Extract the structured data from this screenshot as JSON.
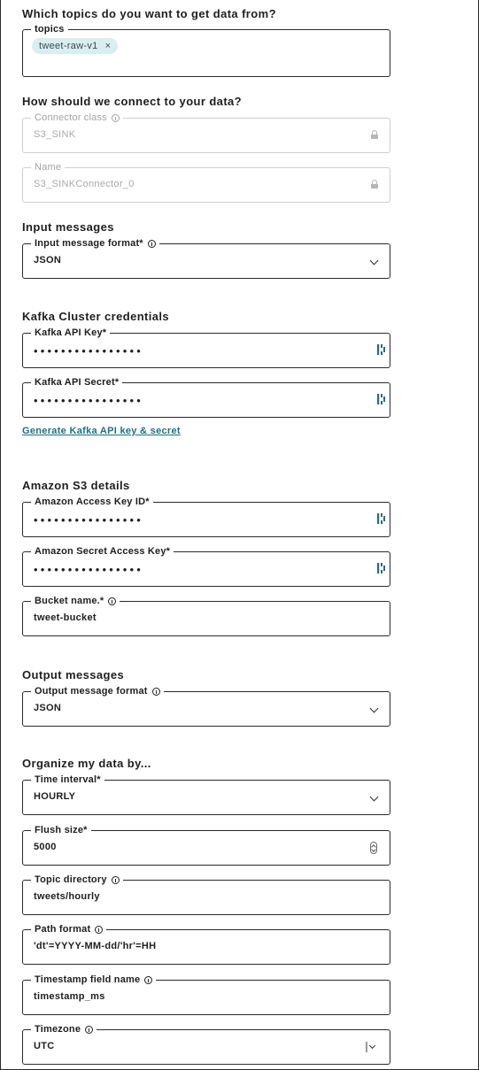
{
  "topics_section": {
    "title": "Which topics do you want to get data from?",
    "label": "topics",
    "chips": [
      "tweet-raw-v1"
    ],
    "chip_remove": "×"
  },
  "connection_section": {
    "title": "How should we connect to your data?",
    "connector_class": {
      "label": "Connector class",
      "value": "S3_SINK"
    },
    "name": {
      "label": "Name",
      "value": "S3_SINKConnector_0"
    }
  },
  "input_section": {
    "title": "Input messages",
    "format": {
      "label": "Input message format*",
      "value": "JSON"
    }
  },
  "kafka_section": {
    "title": "Kafka Cluster credentials",
    "api_key": {
      "label": "Kafka API Key*",
      "value": "••••••••••••••••"
    },
    "api_secret": {
      "label": "Kafka API Secret*",
      "value": "••••••••••••••••"
    },
    "generate_link": "Generate Kafka API key & secret"
  },
  "s3_section": {
    "title": "Amazon S3 details",
    "access_key": {
      "label": "Amazon Access Key ID*",
      "value": "••••••••••••••••"
    },
    "secret_key": {
      "label": "Amazon Secret Access Key*",
      "value": "••••••••••••••••"
    },
    "bucket": {
      "label": "Bucket name.*",
      "value": "tweet-bucket"
    }
  },
  "output_section": {
    "title": "Output messages",
    "format": {
      "label": "Output message format",
      "value": "JSON"
    }
  },
  "organize_section": {
    "title": "Organize my data by...",
    "time_interval": {
      "label": "Time interval*",
      "value": "HOURLY"
    },
    "flush_size": {
      "label": "Flush size*",
      "value": "5000"
    },
    "topic_directory": {
      "label": "Topic directory",
      "value": "tweets/hourly"
    },
    "path_format": {
      "label": "Path format",
      "value": "'dt'=YYYY-MM-dd/'hr'=HH"
    },
    "timestamp_field": {
      "label": "Timestamp field name",
      "value": "timestamp_ms"
    },
    "timezone": {
      "label": "Timezone",
      "value": "UTC"
    }
  },
  "colors": {
    "link": "#1f6f83",
    "chip_bg": "#d9eef0",
    "border": "#2a2a2a",
    "disabled": "#a9a9a9"
  }
}
